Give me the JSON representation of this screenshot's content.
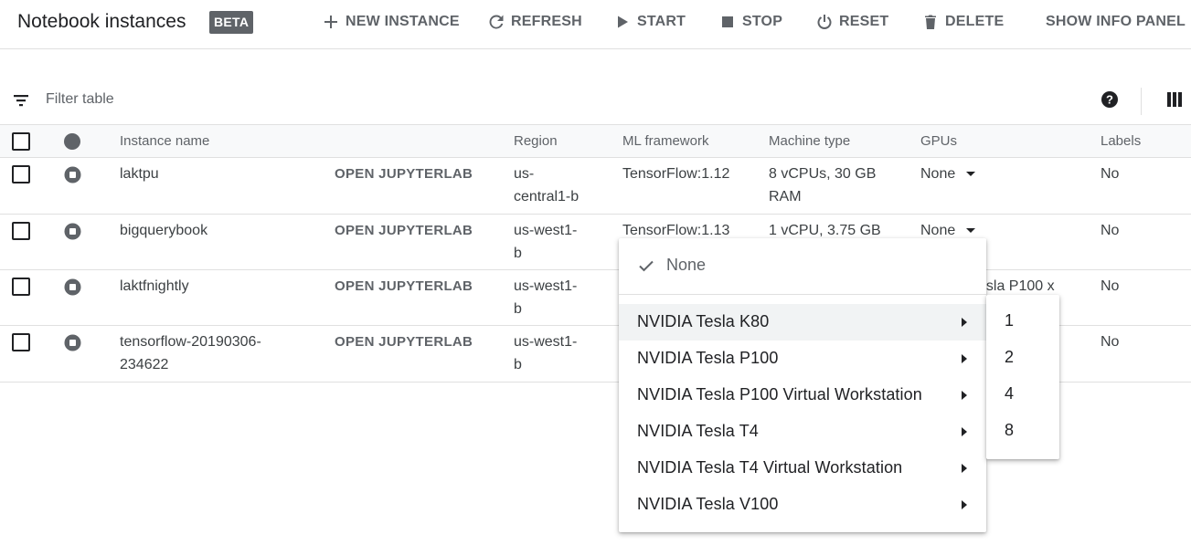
{
  "header": {
    "title": "Notebook instances",
    "badge": "BETA",
    "actions": [
      {
        "label": "NEW INSTANCE",
        "icon": "plus-icon"
      },
      {
        "label": "REFRESH",
        "icon": "refresh-icon"
      },
      {
        "label": "START",
        "icon": "play-icon"
      },
      {
        "label": "STOP",
        "icon": "stop-icon"
      },
      {
        "label": "RESET",
        "icon": "power-icon"
      },
      {
        "label": "DELETE",
        "icon": "trash-icon"
      },
      {
        "label": "SHOW INFO PANEL",
        "icon": ""
      }
    ]
  },
  "filter": {
    "placeholder": "Filter table"
  },
  "table": {
    "columns": [
      "Instance name",
      "Region",
      "ML framework",
      "Machine type",
      "GPUs",
      "Labels"
    ],
    "rows": [
      {
        "name": "laktpu",
        "action": "OPEN JUPYTERLAB",
        "region_l1": "us-",
        "region_l2": "central1-b",
        "framework": "TensorFlow:1.12",
        "machine_l1": "8 vCPUs, 30 GB",
        "machine_l2": "RAM",
        "gpus": "None",
        "labels": "No"
      },
      {
        "name": "bigquerybook",
        "action": "OPEN JUPYTERLAB",
        "region_l1": "us-west1-",
        "region_l2": "b",
        "framework": "TensorFlow:1.13",
        "machine_l1": "1 vCPU, 3.75 GB",
        "machine_l2": "",
        "gpus": "None",
        "labels": "No"
      },
      {
        "name": "laktfnightly",
        "action": "OPEN JUPYTERLAB",
        "region_l1": "us-west1-",
        "region_l2": "b",
        "framework": "",
        "machine_l1": "",
        "machine_l2": "",
        "gpus": "esla P100 x",
        "labels": "No"
      },
      {
        "name_l1": "tensorflow-20190306-",
        "name_l2": "234622",
        "action": "OPEN JUPYTERLAB",
        "region_l1": "us-west1-",
        "region_l2": "b",
        "framework": "",
        "machine_l1": "",
        "machine_l2": "",
        "gpus": "",
        "labels": "No"
      }
    ]
  },
  "gpu_menu": {
    "selected": "None",
    "items": [
      "NVIDIA Tesla K80",
      "NVIDIA Tesla P100",
      "NVIDIA Tesla P100 Virtual Workstation",
      "NVIDIA Tesla T4",
      "NVIDIA Tesla T4 Virtual Workstation",
      "NVIDIA Tesla V100"
    ],
    "active_item": "NVIDIA Tesla K80",
    "count_options": [
      "1",
      "2",
      "4",
      "8"
    ]
  },
  "colors": {
    "text": "#202124",
    "muted": "#5f6368",
    "border": "#e0e0e0",
    "header_bg": "#f8f9fa",
    "badge_bg": "#5f6368",
    "menu_hover": "#f1f3f4"
  }
}
